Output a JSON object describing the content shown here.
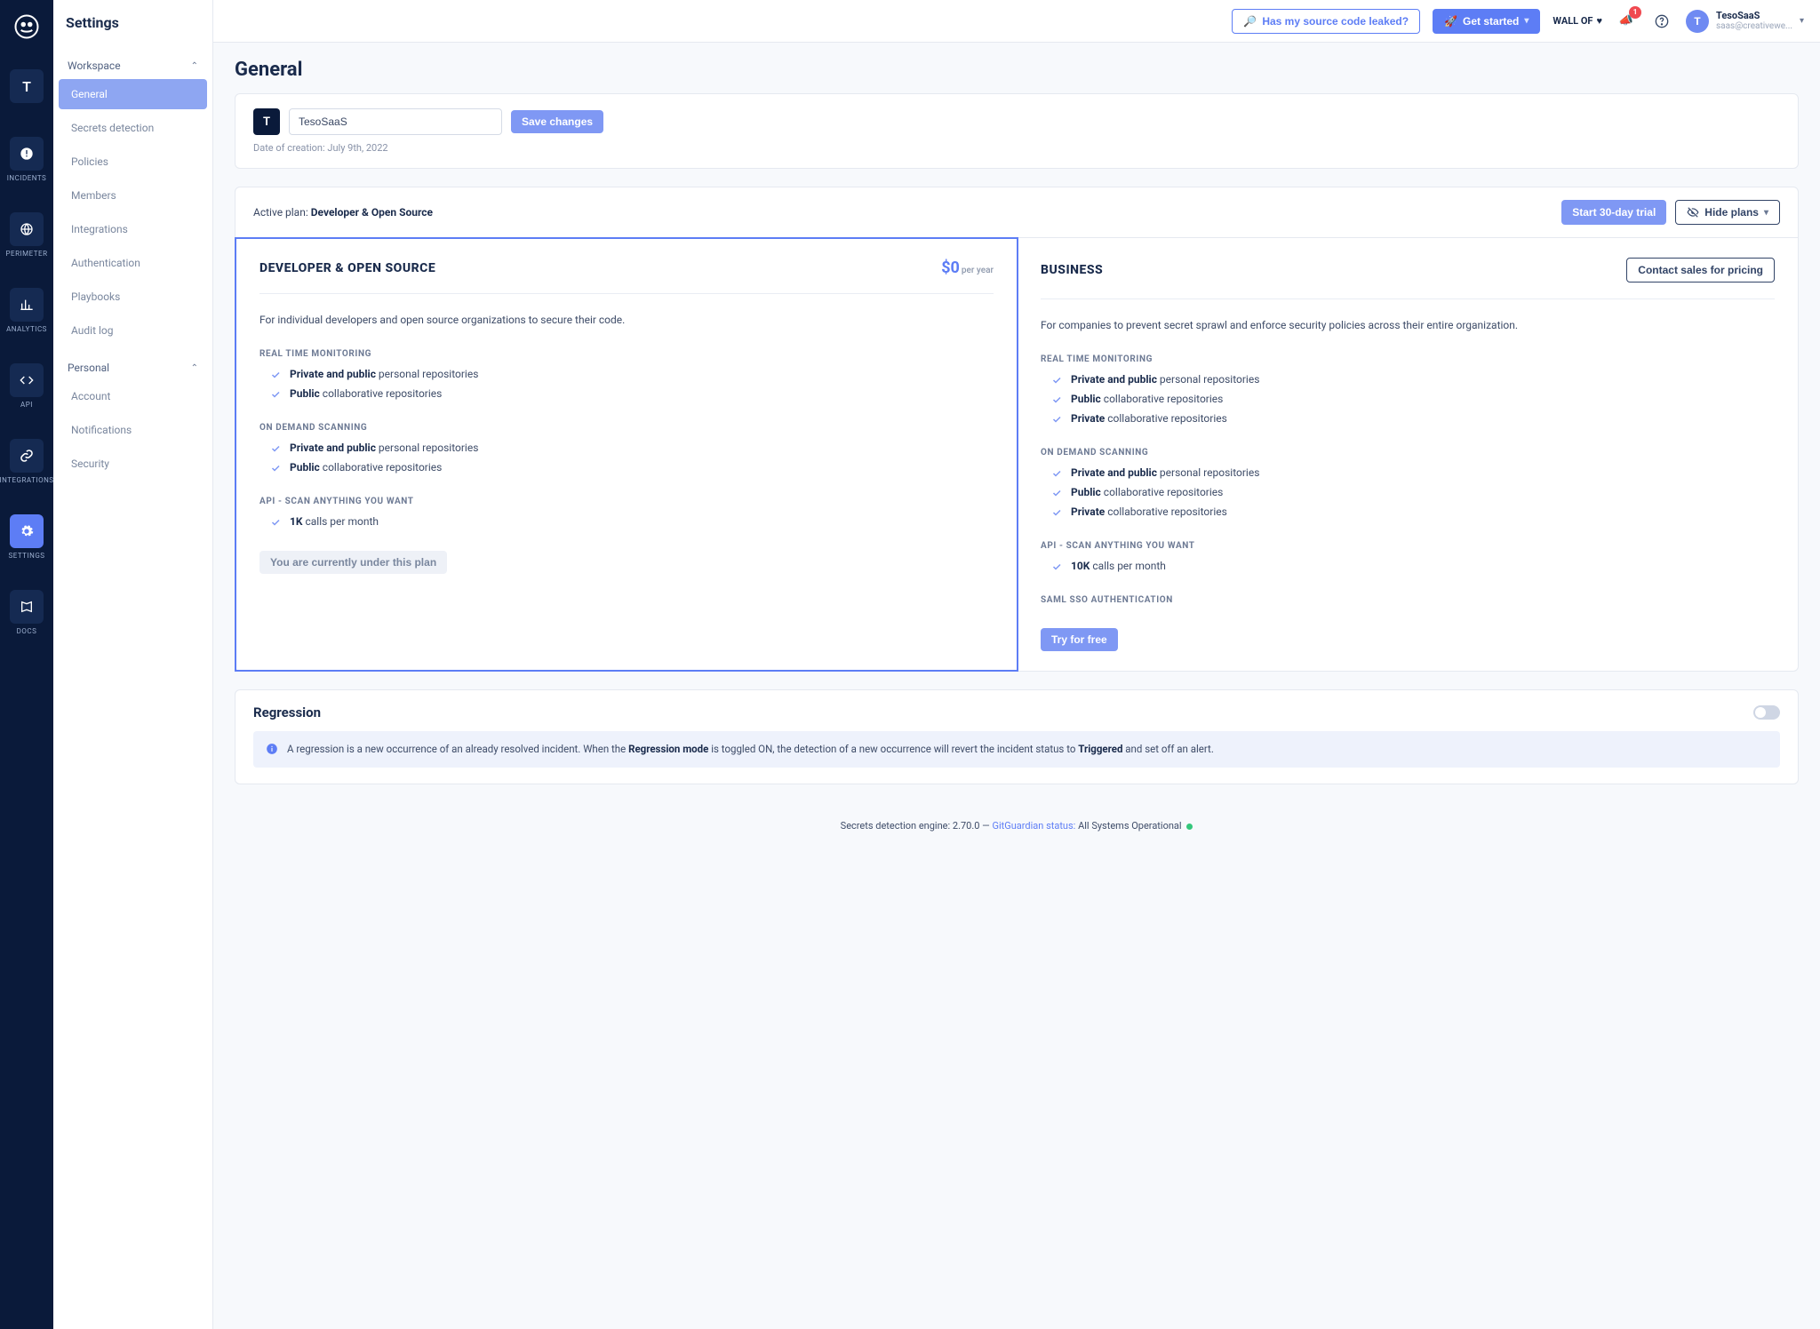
{
  "rail": {
    "avatar_letter": "T",
    "items": [
      {
        "label": "INCIDENTS",
        "icon": "alert"
      },
      {
        "label": "PERIMETER",
        "icon": "globe"
      },
      {
        "label": "ANALYTICS",
        "icon": "chart"
      },
      {
        "label": "API",
        "icon": "code"
      },
      {
        "label": "INTEGRATIONS",
        "icon": "link"
      },
      {
        "label": "SETTINGS",
        "icon": "gear",
        "active": true
      },
      {
        "label": "DOCS",
        "icon": "book"
      }
    ]
  },
  "sidebar": {
    "title": "Settings",
    "sections": {
      "workspace": {
        "label": "Workspace",
        "items": [
          "General",
          "Secrets detection",
          "Policies",
          "Members",
          "Integrations",
          "Authentication",
          "Playbooks",
          "Audit log"
        ]
      },
      "personal": {
        "label": "Personal",
        "items": [
          "Account",
          "Notifications",
          "Security"
        ]
      }
    }
  },
  "topbar": {
    "leak_button": "Has my source code leaked?",
    "get_started": "Get started",
    "wall_of": "WALL OF",
    "notif_badge": "1",
    "user_letter": "T",
    "user_name": "TesoSaaS",
    "user_email": "saas@creativewe..."
  },
  "page_title": "General",
  "workspace_card": {
    "avatar_letter": "T",
    "name_value": "TesoSaaS",
    "save_label": "Save changes",
    "creation_label": "Date of creation: July 9th, 2022"
  },
  "plans": {
    "active_label": "Active plan: ",
    "active_plan": "Developer & Open Source",
    "start_trial": "Start 30-day trial",
    "hide_plans": "Hide plans",
    "columns": [
      {
        "key": "dev",
        "name": "DEVELOPER & OPEN SOURCE",
        "price": "$0",
        "price_unit": "per year",
        "desc": "For individual developers and open source organizations to secure their code.",
        "groups": [
          {
            "title": "REAL TIME MONITORING",
            "items": [
              {
                "bold": "Private and public",
                "rest": " personal repositories"
              },
              {
                "bold": "Public",
                "rest": " collaborative repositories"
              }
            ]
          },
          {
            "title": "ON DEMAND SCANNING",
            "items": [
              {
                "bold": "Private and public",
                "rest": " personal repositories"
              },
              {
                "bold": "Public",
                "rest": " collaborative repositories"
              }
            ]
          },
          {
            "title": "API - SCAN ANYTHING YOU WANT",
            "items": [
              {
                "bold": "1K",
                "rest": " calls per month"
              }
            ]
          }
        ],
        "cta": "You are currently under this plan",
        "cta_style": "disabled",
        "highlighted": true
      },
      {
        "key": "biz",
        "name": "BUSINESS",
        "contact_label": "Contact sales for pricing",
        "desc": "For companies to prevent secret sprawl and enforce security policies across their entire organization.",
        "groups": [
          {
            "title": "REAL TIME MONITORING",
            "items": [
              {
                "bold": "Private and public",
                "rest": " personal repositories"
              },
              {
                "bold": "Public",
                "rest": " collaborative repositories"
              },
              {
                "bold": "Private",
                "rest": " collaborative repositories"
              }
            ]
          },
          {
            "title": "ON DEMAND SCANNING",
            "items": [
              {
                "bold": "Private and public",
                "rest": " personal repositories"
              },
              {
                "bold": "Public",
                "rest": " collaborative repositories"
              },
              {
                "bold": "Private",
                "rest": " collaborative repositories"
              }
            ]
          },
          {
            "title": "API - SCAN ANYTHING YOU WANT",
            "items": [
              {
                "bold": "10K",
                "rest": " calls per month"
              }
            ]
          },
          {
            "title": "SAML SSO AUTHENTICATION",
            "items": []
          }
        ],
        "cta": "Try for free",
        "cta_style": "primary"
      }
    ]
  },
  "regression": {
    "title": "Regression",
    "info_pre": "A regression is a new occurrence of an already resolved incident. When the ",
    "info_b1": "Regression mode",
    "info_mid": " is toggled ON, the detection of a new occurrence will revert the incident status to ",
    "info_b2": "Triggered",
    "info_end": " and set off an alert."
  },
  "footer": {
    "engine": "Secrets detection engine: 2.70.0 — ",
    "status_link": "GitGuardian status:",
    "status_text": "  All Systems Operational "
  }
}
